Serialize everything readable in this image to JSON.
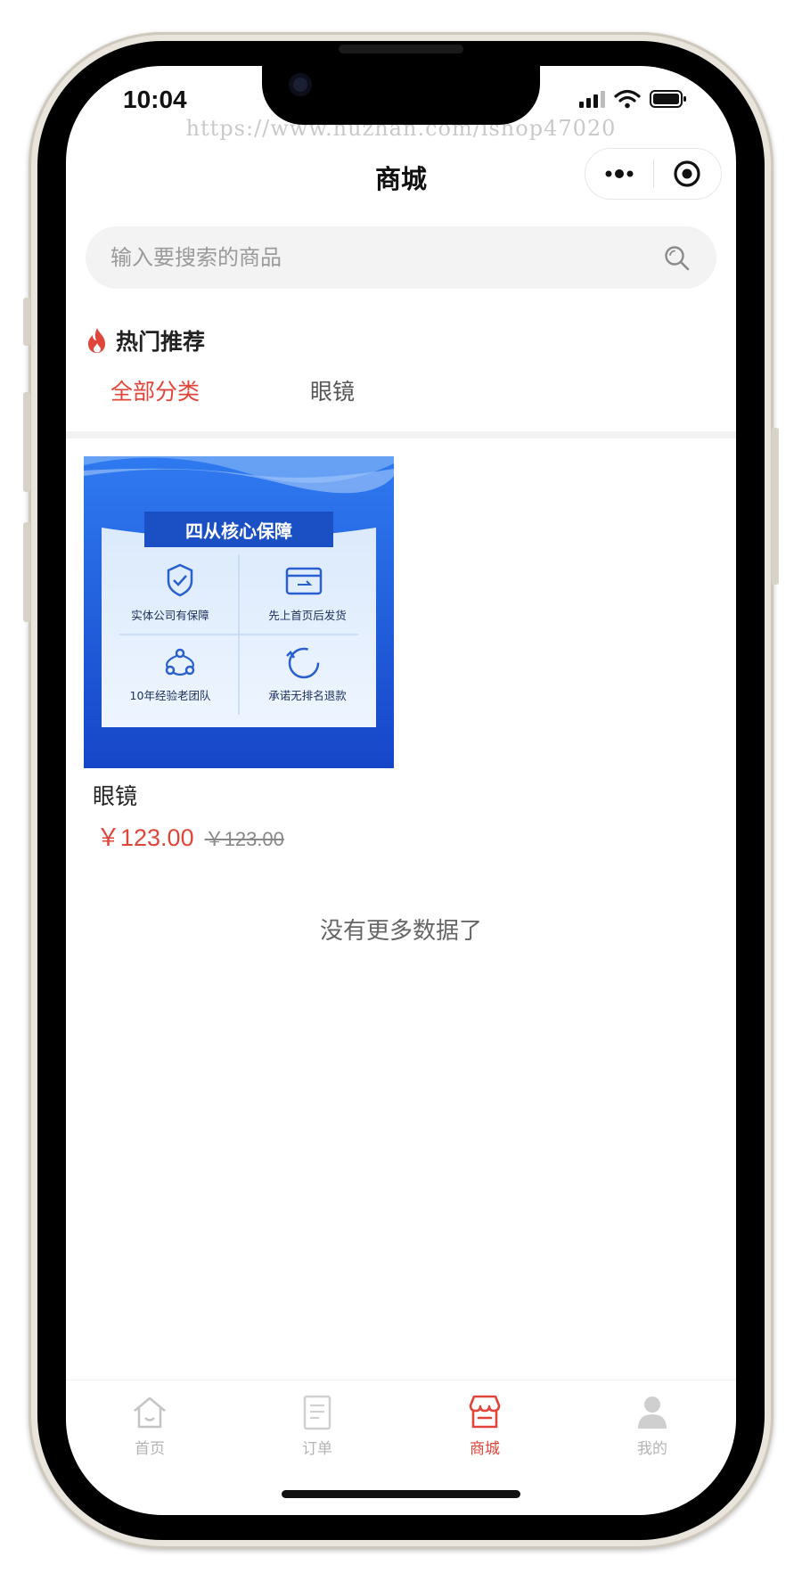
{
  "status_bar": {
    "time": "10:04"
  },
  "watermark": "https://www.huzhan.com/ishop47020",
  "header": {
    "title": "商城"
  },
  "search": {
    "placeholder": "输入要搜索的商品"
  },
  "hot_section": {
    "title": "热门推荐",
    "tabs": [
      {
        "label": "全部分类",
        "active": true
      },
      {
        "label": "眼镜",
        "active": false
      }
    ]
  },
  "products": [
    {
      "name": "眼镜",
      "price": "￥123.00",
      "original_price": "￥123.00",
      "image": {
        "banner_title": "四从核心保障",
        "features": [
          "实体公司有保障",
          "先上首页后发货",
          "10年经验老团队",
          "承诺无排名退款"
        ]
      }
    }
  ],
  "list_end_text": "没有更多数据了",
  "tabbar": {
    "items": [
      {
        "label": "首页",
        "icon": "home-icon",
        "active": false
      },
      {
        "label": "订单",
        "icon": "order-icon",
        "active": false
      },
      {
        "label": "商城",
        "icon": "store-icon",
        "active": true
      },
      {
        "label": "我的",
        "icon": "user-icon",
        "active": false
      }
    ]
  },
  "colors": {
    "accent": "#e0453a",
    "banner_blue": "#1c57d6",
    "inactive": "#b4b4b4"
  }
}
